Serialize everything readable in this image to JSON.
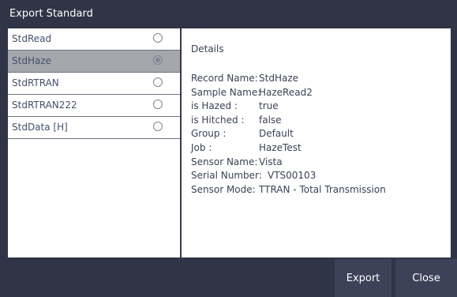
{
  "window": {
    "title": "Export Standard"
  },
  "standards": [
    {
      "label": "StdRead",
      "selected": false
    },
    {
      "label": "StdHaze",
      "selected": true
    },
    {
      "label": "StdRTRAN",
      "selected": false
    },
    {
      "label": "StdRTRAN222",
      "selected": false
    },
    {
      "label": "StdData [H]",
      "selected": false
    }
  ],
  "details": {
    "heading": "Details",
    "rows": [
      {
        "key": "Record Name:",
        "value": "StdHaze"
      },
      {
        "key": "Sample Name:",
        "value": "HazeRead2"
      },
      {
        "key": "is Hazed :",
        "value": "true"
      },
      {
        "key": "is Hitched :",
        "value": "false"
      },
      {
        "key": "Group :",
        "value": "Default"
      },
      {
        "key": "Job :",
        "value": "HazeTest"
      },
      {
        "key": "Sensor Name:",
        "value": "Vista"
      },
      {
        "key": "Serial Number:",
        "value": "VTS00103"
      },
      {
        "key": "Sensor Mode:",
        "value": "TTRAN - Total Transmission"
      }
    ]
  },
  "buttons": {
    "export": "Export",
    "close": "Close"
  },
  "colors": {
    "chrome": "#2f3446",
    "button_bg": "#3c4257",
    "selected_row": "#a6a6ad",
    "text": "#3a4256"
  }
}
